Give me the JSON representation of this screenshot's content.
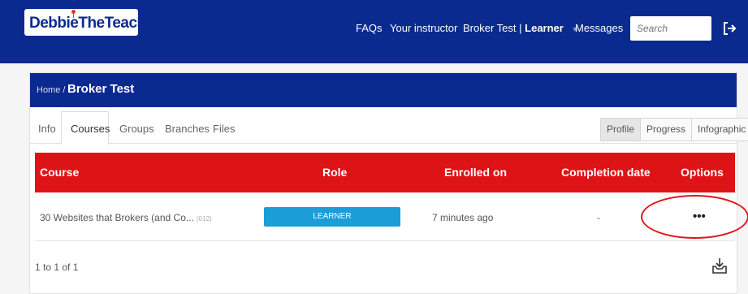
{
  "header": {
    "logo": "DebbieTheTeacher",
    "nav": [
      "FAQs",
      "Your instructor"
    ],
    "user": {
      "name": "Broker Test",
      "separator": "|",
      "role": "Learner"
    },
    "messages": "Messages",
    "search_placeholder": "Search",
    "colors": {
      "bar": "#0b2a8f",
      "accent_red": "#dd1316"
    }
  },
  "breadcrumb": {
    "home": "Home /",
    "current": "Broker Test"
  },
  "tabs": [
    "Info",
    "Courses",
    "Groups",
    "Branches",
    "Files"
  ],
  "active_tab": "Courses",
  "view_buttons": [
    "Profile",
    "Progress",
    "Infographic"
  ],
  "active_view": "Profile",
  "table": {
    "columns": [
      "Course",
      "Role",
      "Enrolled on",
      "Completion date",
      "Options"
    ],
    "rows": [
      {
        "course": "30 Websites that Brokers (and Co...",
        "course_code": "(012)",
        "role": "LEARNER",
        "enrolled_on": "7 minutes ago",
        "completion_date": "-",
        "options": "•••"
      }
    ]
  },
  "pagination": "1 to 1 of 1",
  "icons": [
    "logout-icon",
    "export-icon",
    "options-menu-icon"
  ]
}
